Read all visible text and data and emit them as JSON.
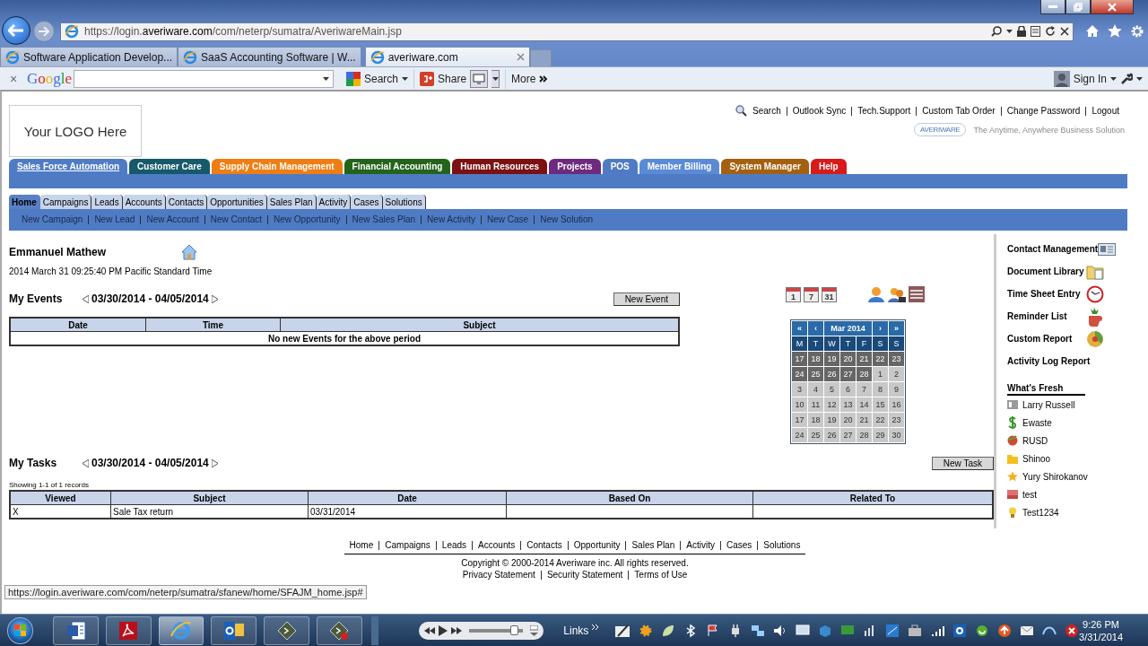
{
  "browser": {
    "url": "https://login.**averiware.com**/com/neterp/sumatra/AveriwareMain.jsp",
    "tabs": [
      {
        "label": "Software Application Develop...",
        "selected": false
      },
      {
        "label": "SaaS Accounting Software | W...",
        "selected": false
      },
      {
        "label": "averiware.com",
        "selected": true
      }
    ],
    "toolbar": {
      "close": "×",
      "logo": "Google",
      "search": "Search",
      "share": "Share",
      "more": "More",
      "sign_in": "Sign In"
    }
  },
  "page": {
    "logo": "Your LOGO Here",
    "top_links": [
      "Search",
      "Outlook Sync",
      "Tech.Support",
      "Custom Tab Order",
      "Change Password",
      "Logout"
    ],
    "brand": "AVERIWARE",
    "tagline": "The Anytime, Anywhere Business Solution",
    "modules": [
      {
        "label": "Sales Force Automation",
        "color": "#4f7bc4",
        "selected": true
      },
      {
        "label": "Customer Care",
        "color": "#16596a",
        "selected": false
      },
      {
        "label": "Supply Chain Management",
        "color": "#f07d14",
        "selected": false
      },
      {
        "label": "Financial Accounting",
        "color": "#23631b",
        "selected": false
      },
      {
        "label": "Human Resources",
        "color": "#7c1111",
        "selected": false
      },
      {
        "label": "Projects",
        "color": "#6e2a7e",
        "selected": false
      },
      {
        "label": "POS",
        "color": "#4f7bc4",
        "selected": false
      },
      {
        "label": "Member Billing",
        "color": "#5b8ad6",
        "selected": false
      },
      {
        "label": "System Manager",
        "color": "#a3600f",
        "selected": false
      },
      {
        "label": "Help",
        "color": "#d81a1a",
        "selected": false
      }
    ],
    "subtabs": [
      {
        "label": "Home",
        "selected": true
      },
      {
        "label": "Campaigns",
        "selected": false
      },
      {
        "label": "Leads",
        "selected": false
      },
      {
        "label": "Accounts",
        "selected": false
      },
      {
        "label": "Contacts",
        "selected": false
      },
      {
        "label": "Opportunities",
        "selected": false
      },
      {
        "label": "Sales Plan",
        "selected": false
      },
      {
        "label": "Activity",
        "selected": false
      },
      {
        "label": "Cases",
        "selected": false
      },
      {
        "label": "Solutions",
        "selected": false
      }
    ],
    "actions": [
      "New Campaign",
      "New Lead",
      "New Account",
      "New Contact",
      "New Opportunity",
      "New Sales Plan",
      "New Activity",
      "New Case",
      "New Solution"
    ],
    "user": {
      "name": "Emmanuel Mathew",
      "datetime": "2014 March 31 09:25:40 PM Pacific Standard Time"
    },
    "events": {
      "title": "My Events",
      "range": "03/30/2014 - 04/05/2014",
      "button": "New Event",
      "columns": [
        "Date",
        "Time",
        "Subject"
      ],
      "empty": "No new Events for the above period"
    },
    "calendar_views": [
      "1",
      "7",
      "31"
    ],
    "calendar": {
      "nav": [
        "«",
        "‹",
        "›",
        "»"
      ],
      "title": "Mar 2014",
      "weekdays": [
        "M",
        "T",
        "W",
        "T",
        "F",
        "S",
        "S"
      ],
      "weeks": [
        [
          {
            "d": "17",
            "in_month": false
          },
          {
            "d": "18",
            "in_month": false
          },
          {
            "d": "19",
            "in_month": false
          },
          {
            "d": "20",
            "in_month": false
          },
          {
            "d": "21",
            "in_month": false
          },
          {
            "d": "22",
            "in_month": false
          },
          {
            "d": "23",
            "in_month": false
          }
        ],
        [
          {
            "d": "24",
            "in_month": false
          },
          {
            "d": "25",
            "in_month": false
          },
          {
            "d": "26",
            "in_month": false
          },
          {
            "d": "27",
            "in_month": false
          },
          {
            "d": "28",
            "in_month": false
          },
          {
            "d": "1",
            "in_month": true
          },
          {
            "d": "2",
            "in_month": true
          }
        ],
        [
          {
            "d": "3",
            "in_month": true
          },
          {
            "d": "4",
            "in_month": true
          },
          {
            "d": "5",
            "in_month": true
          },
          {
            "d": "6",
            "in_month": true
          },
          {
            "d": "7",
            "in_month": true
          },
          {
            "d": "8",
            "in_month": true
          },
          {
            "d": "9",
            "in_month": true
          }
        ],
        [
          {
            "d": "10",
            "in_month": true
          },
          {
            "d": "11",
            "in_month": true
          },
          {
            "d": "12",
            "in_month": true
          },
          {
            "d": "13",
            "in_month": true
          },
          {
            "d": "14",
            "in_month": true
          },
          {
            "d": "15",
            "in_month": true
          },
          {
            "d": "16",
            "in_month": true
          }
        ],
        [
          {
            "d": "17",
            "in_month": true
          },
          {
            "d": "18",
            "in_month": true
          },
          {
            "d": "19",
            "in_month": true
          },
          {
            "d": "20",
            "in_month": true
          },
          {
            "d": "21",
            "in_month": true
          },
          {
            "d": "22",
            "in_month": true
          },
          {
            "d": "23",
            "in_month": true
          }
        ],
        [
          {
            "d": "24",
            "in_month": true
          },
          {
            "d": "25",
            "in_month": true
          },
          {
            "d": "26",
            "in_month": true
          },
          {
            "d": "27",
            "in_month": true
          },
          {
            "d": "28",
            "in_month": true
          },
          {
            "d": "29",
            "in_month": true
          },
          {
            "d": "30",
            "in_month": true
          }
        ]
      ]
    },
    "tasks": {
      "title": "My Tasks",
      "range": "03/30/2014 - 04/05/2014",
      "button": "New Task",
      "count": "Showing 1-1 of 1 records",
      "columns": [
        "Viewed",
        "Subject",
        "Date",
        "Based On",
        "Related To"
      ],
      "rows": [
        {
          "viewed": "X",
          "subject": "Sale Tax return",
          "date": "03/31/2014"
        }
      ]
    },
    "side_links": [
      "Contact Management",
      "Document Library",
      "Time Sheet Entry",
      "Reminder List",
      "Custom Report",
      "Activity Log Report"
    ],
    "whats_fresh": {
      "title": "What's Fresh",
      "items": [
        "Larry Russell",
        "Ewaste",
        "RUSD",
        "Shinoo",
        "Yury Shirokanov",
        "test",
        "Test1234"
      ]
    },
    "footer": {
      "links": [
        "Home",
        "Campaigns",
        "Leads",
        "Accounts",
        "Contacts",
        "Opportunity",
        "Sales Plan",
        "Activity",
        "Cases",
        "Solutions"
      ],
      "copyright": "Copyright © 2000-2014 Averiware inc. All rights reserved.",
      "legal": [
        "Privacy Statement",
        "Security Statement",
        "Terms of Use"
      ]
    }
  },
  "status_url": "https://login.averiware.com/com/neterp/sumatra/sfanew/home/SFAJM_home.jsp#",
  "taskbar": {
    "apps": [
      {
        "selected": false
      },
      {
        "selected": false
      },
      {
        "selected": true
      },
      {
        "selected": false
      },
      {
        "selected": false
      },
      {
        "selected": false
      }
    ],
    "volume": {
      "level": 0.85
    },
    "links": "Links",
    "time": "9:26 PM",
    "date": "3/31/2014"
  }
}
